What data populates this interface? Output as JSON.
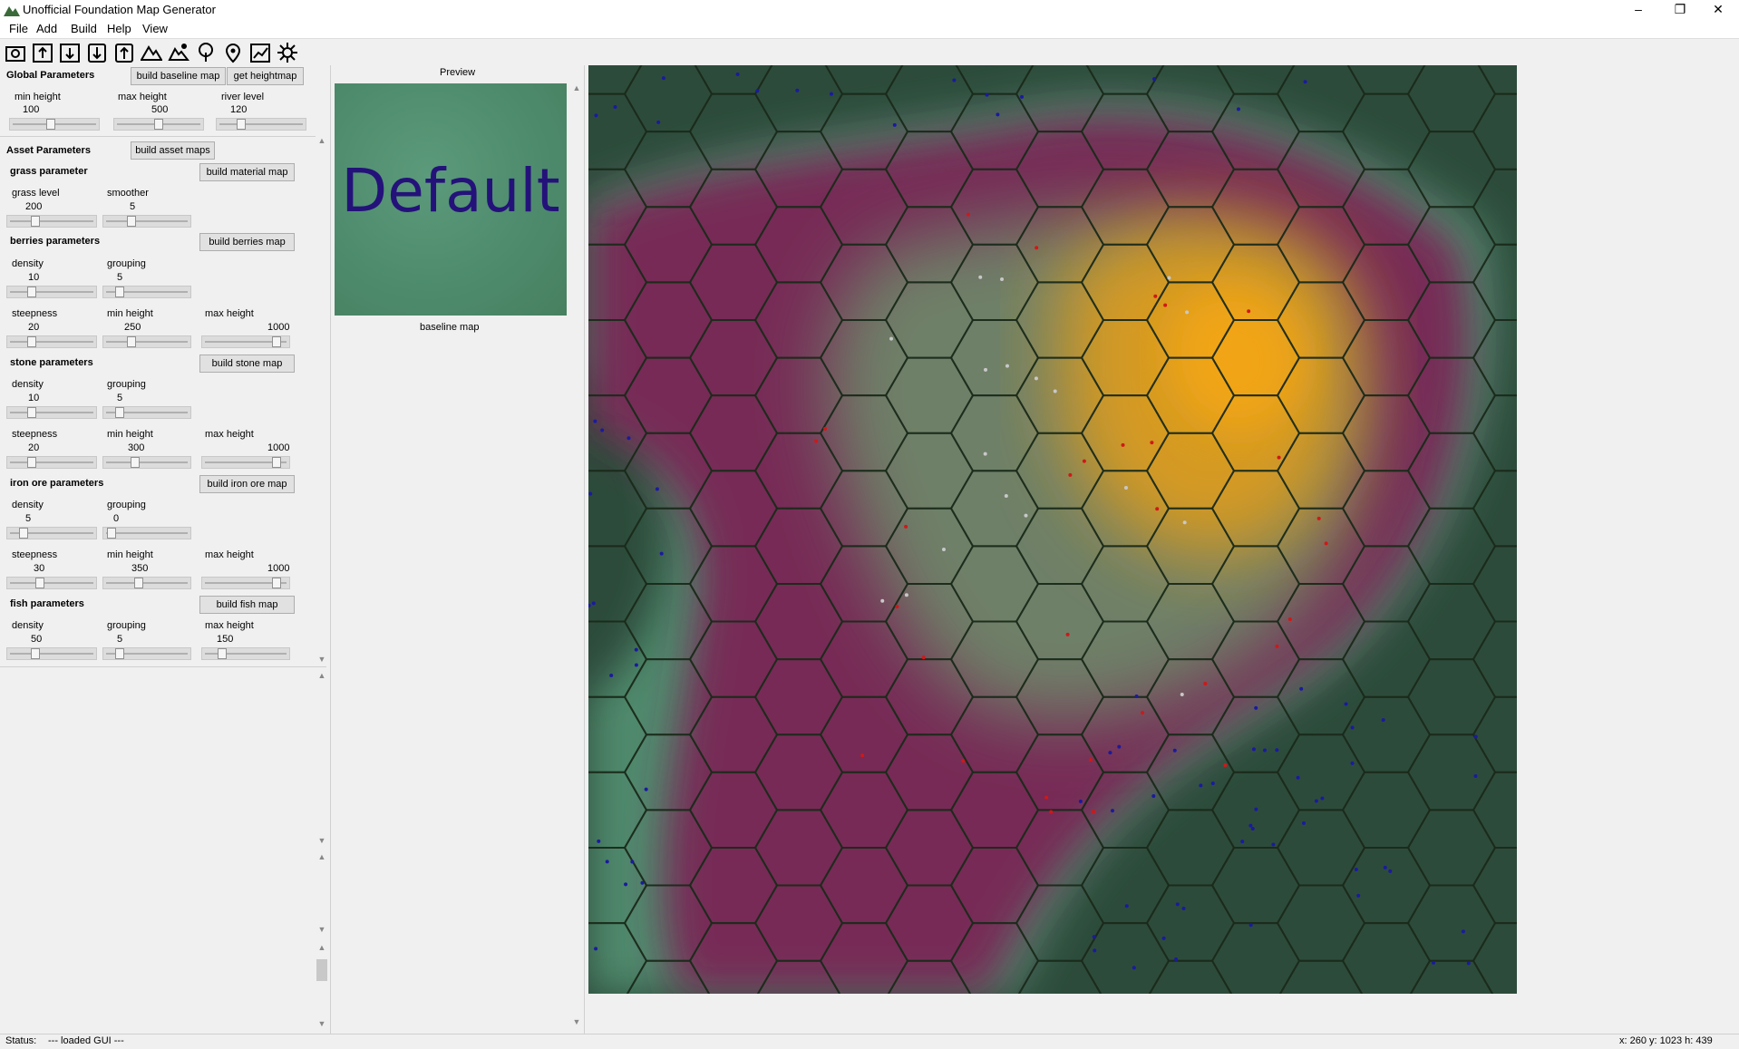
{
  "window": {
    "title": "Unofficial Foundation Map Generator"
  },
  "menu": [
    "File",
    "Add",
    "Build",
    "Help",
    "View"
  ],
  "toolbar_icons": [
    "camera-icon",
    "upload-icon",
    "import-icon",
    "download-icon",
    "export-icon",
    "mountain-icon",
    "terrain-icon",
    "tree-icon",
    "map-pin-icon",
    "chart-icon",
    "settings-icon"
  ],
  "global": {
    "title": "Global Parameters",
    "build_baseline": "build baseline map",
    "get_heightmap": "get heightmap",
    "min_height": {
      "label": "min height",
      "value": "100",
      "level": 0.45
    },
    "max_height": {
      "label": "max height",
      "value": "500",
      "level": 0.5
    },
    "river_level": {
      "label": "river level",
      "value": "120",
      "level": 0.25
    }
  },
  "asset": {
    "title": "Asset Parameters",
    "build_asset_maps": "build asset maps",
    "grass": {
      "title": "grass parameter",
      "button": "build material map",
      "grass_level": {
        "label": "grass level",
        "value": "200",
        "level": 0.3
      },
      "smoother": {
        "label": "smoother",
        "value": "5",
        "level": 0.3
      }
    },
    "berries": {
      "title": "berries parameters",
      "button": "build berries map",
      "density": {
        "label": "density",
        "value": "10",
        "level": 0.25
      },
      "grouping": {
        "label": "grouping",
        "value": "5",
        "level": 0.15
      },
      "steepness": {
        "label": "steepness",
        "value": "20",
        "level": 0.25
      },
      "min_height": {
        "label": "min height",
        "value": "250",
        "level": 0.3
      },
      "max_height": {
        "label": "max height",
        "value": "1000",
        "level": 0.9
      }
    },
    "stone": {
      "title": "stone parameters",
      "button": "build stone map",
      "density": {
        "label": "density",
        "value": "10",
        "level": 0.25
      },
      "grouping": {
        "label": "grouping",
        "value": "5",
        "level": 0.15
      },
      "steepness": {
        "label": "steepness",
        "value": "20",
        "level": 0.25
      },
      "min_height": {
        "label": "min height",
        "value": "300",
        "level": 0.35
      },
      "max_height": {
        "label": "max height",
        "value": "1000",
        "level": 0.9
      }
    },
    "iron": {
      "title": "iron ore parameters",
      "button": "build iron ore map",
      "density": {
        "label": "density",
        "value": "5",
        "level": 0.15
      },
      "grouping": {
        "label": "grouping",
        "value": "0",
        "level": 0.05
      },
      "steepness": {
        "label": "steepness",
        "value": "30",
        "level": 0.35
      },
      "min_height": {
        "label": "min height",
        "value": "350",
        "level": 0.4
      },
      "max_height": {
        "label": "max height",
        "value": "1000",
        "level": 0.9
      }
    },
    "fish": {
      "title": "fish parameters",
      "button": "build fish map",
      "density": {
        "label": "density",
        "value": "50",
        "level": 0.3
      },
      "grouping": {
        "label": "grouping",
        "value": "5",
        "level": 0.15
      },
      "max_height": {
        "label": "max height",
        "value": "150",
        "level": 0.2
      }
    }
  },
  "preview": {
    "title": "Preview",
    "thumb_text": "Default",
    "caption": "baseline map"
  },
  "status": {
    "label": "Status:",
    "text": "--- loaded GUI ---",
    "coords": "x: 260 y: 1023 h: 439"
  }
}
